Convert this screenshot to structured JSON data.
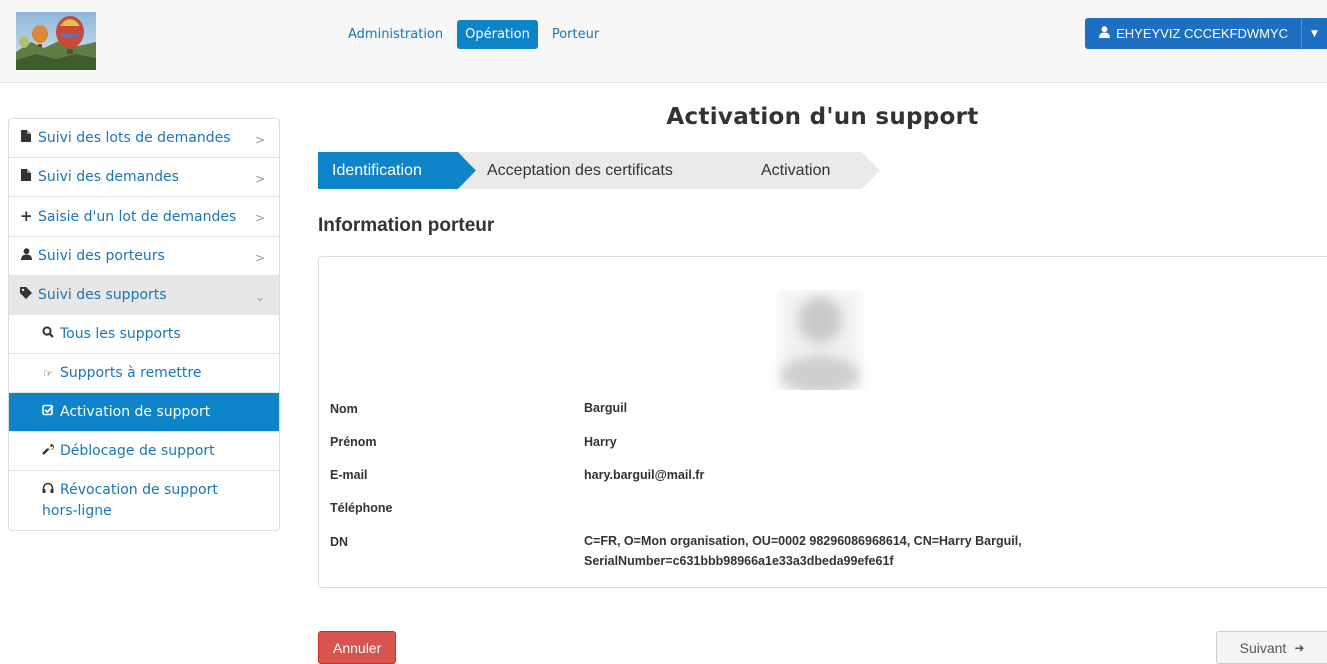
{
  "header": {
    "nav": [
      {
        "label": "Administration"
      },
      {
        "label": "Opération"
      },
      {
        "label": "Porteur"
      }
    ],
    "user": {
      "name": "EHYEYVIZ CCCEKFDWMYC",
      "icon": "user-icon"
    }
  },
  "sidebar": {
    "items": [
      {
        "label": "Suivi des lots de demandes",
        "icon": "file-icon"
      },
      {
        "label": "Suivi des demandes",
        "icon": "file-icon"
      },
      {
        "label": "Saisie d'un lot de demandes",
        "icon": "plus-icon"
      },
      {
        "label": "Suivi des porteurs",
        "icon": "user-icon"
      },
      {
        "label": "Suivi des supports",
        "icon": "tags-icon"
      },
      {
        "label": "Tous les supports",
        "icon": "search-icon"
      },
      {
        "label": "Supports à remettre",
        "icon": "hand-right-icon"
      },
      {
        "label": "Activation de support",
        "icon": "check-icon"
      },
      {
        "label": "Déblocage de support",
        "icon": "wrench-icon"
      },
      {
        "label": "Révocation de support hors-ligne",
        "icon": "headphones-icon"
      }
    ]
  },
  "main": {
    "title": "Activation d'un support",
    "steps": [
      {
        "label": "Identification",
        "state": "active"
      },
      {
        "label": "Acceptation des certificats",
        "state": "inactive"
      },
      {
        "label": "Activation",
        "state": "inactive"
      }
    ],
    "section_title": "Information porteur",
    "info": {
      "nom_label": "Nom",
      "nom_value": "Barguil",
      "prenom_label": "Prénom",
      "prenom_value": "Harry",
      "email_label": "E-mail",
      "email_value": "hary.barguil@mail.fr",
      "tel_label": "Téléphone",
      "tel_value": "",
      "dn_label": "DN",
      "dn_line1": "C=FR, O=Mon organisation, OU=0002 98296086968614, CN=Harry Barguil,",
      "dn_line2": "SerialNumber=c631bbb98966a1e33a3dbeda99efe61f"
    },
    "buttons": {
      "cancel": "Annuler",
      "next": "Suivant",
      "next_icon": "arrow-right-icon"
    }
  },
  "colors": {
    "primary": "#0e84c8",
    "danger": "#d9534f",
    "link": "#1a76b8"
  }
}
